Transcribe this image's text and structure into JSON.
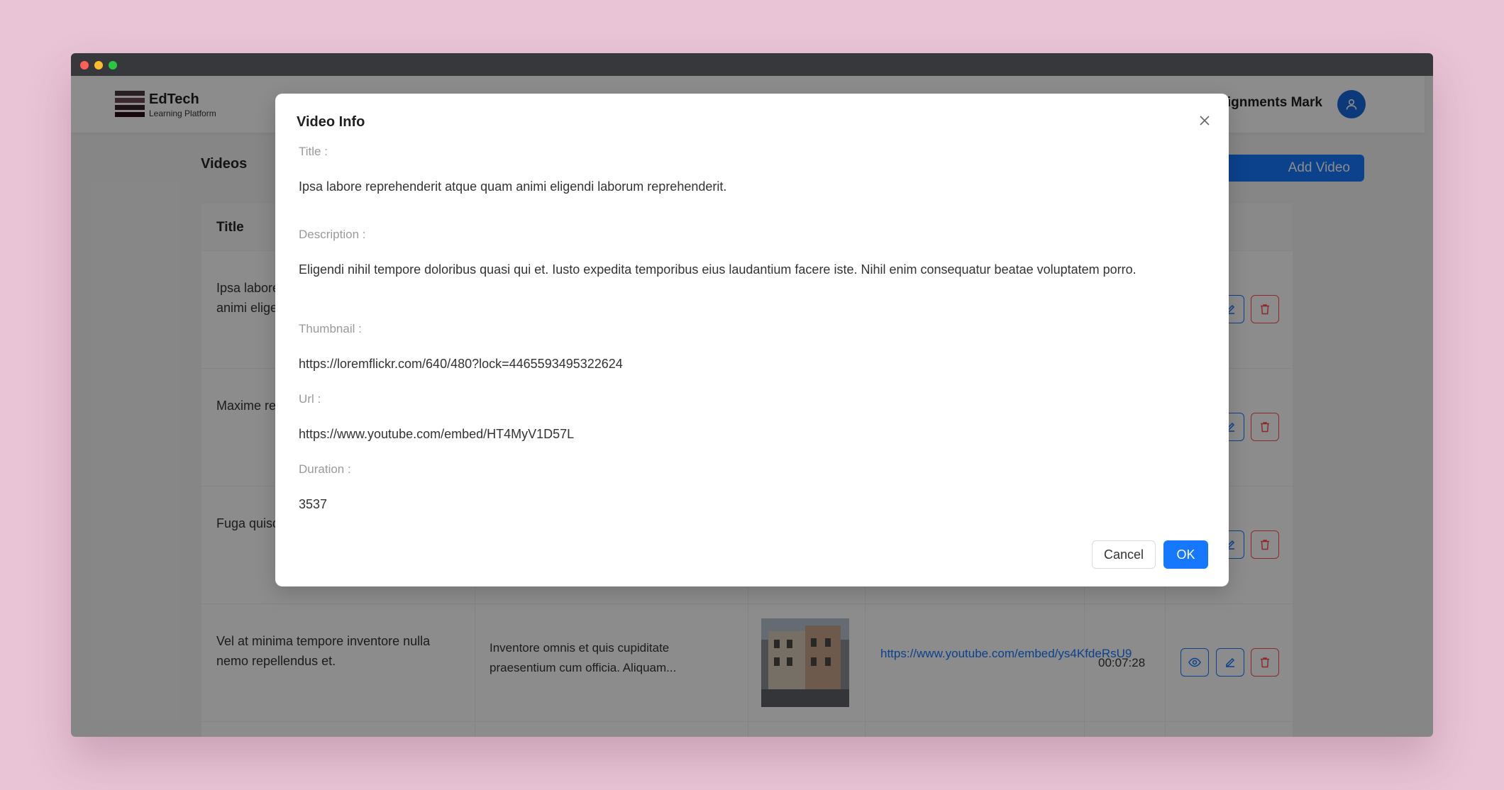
{
  "colors": {
    "primary": "#1677ff",
    "danger": "#ff4d4f",
    "background": "#e8c4d6"
  },
  "navbar": {
    "brand_name": "EdTech",
    "brand_sub": "Learning Platform",
    "nav_link": "Assignments Mark",
    "avatar_icon": "user-icon"
  },
  "page": {
    "title": "Videos",
    "add_button": "Add Video"
  },
  "table": {
    "header_title": "Title",
    "rows": [
      {
        "title": "Ipsa labore reprehenderit atque quam animi eligendi laborum reprehenderit."
      },
      {
        "title": "Maxime rem voluptatibus"
      },
      {
        "title": "Fuga quisquam minima."
      },
      {
        "title": "Vel at minima tempore inventore nulla nemo repellendus et.",
        "description": "Inventore omnis et quis cupiditate praesentium cum officia. Aliquam...",
        "url": "https://www.youtube.com/embed/ys4KfdeRsU9",
        "duration": "00:07:28"
      }
    ],
    "action_icons": [
      "eye-icon",
      "edit-icon",
      "trash-icon"
    ]
  },
  "modal": {
    "title": "Video Info",
    "fields": {
      "title_label": "Title :",
      "title_value": "Ipsa labore reprehenderit atque quam animi eligendi laborum reprehenderit.",
      "description_label": "Description :",
      "description_value": "Eligendi nihil tempore doloribus quasi qui et. Iusto expedita temporibus eius laudantium facere iste. Nihil enim consequatur beatae voluptatem porro.",
      "thumbnail_label": "Thumbnail :",
      "thumbnail_value": "https://loremflickr.com/640/480?lock=4465593495322624",
      "url_label": "Url :",
      "url_value": "https://www.youtube.com/embed/HT4MyV1D57L",
      "duration_label": "Duration :",
      "duration_value": "3537"
    },
    "cancel_label": "Cancel",
    "ok_label": "OK"
  }
}
